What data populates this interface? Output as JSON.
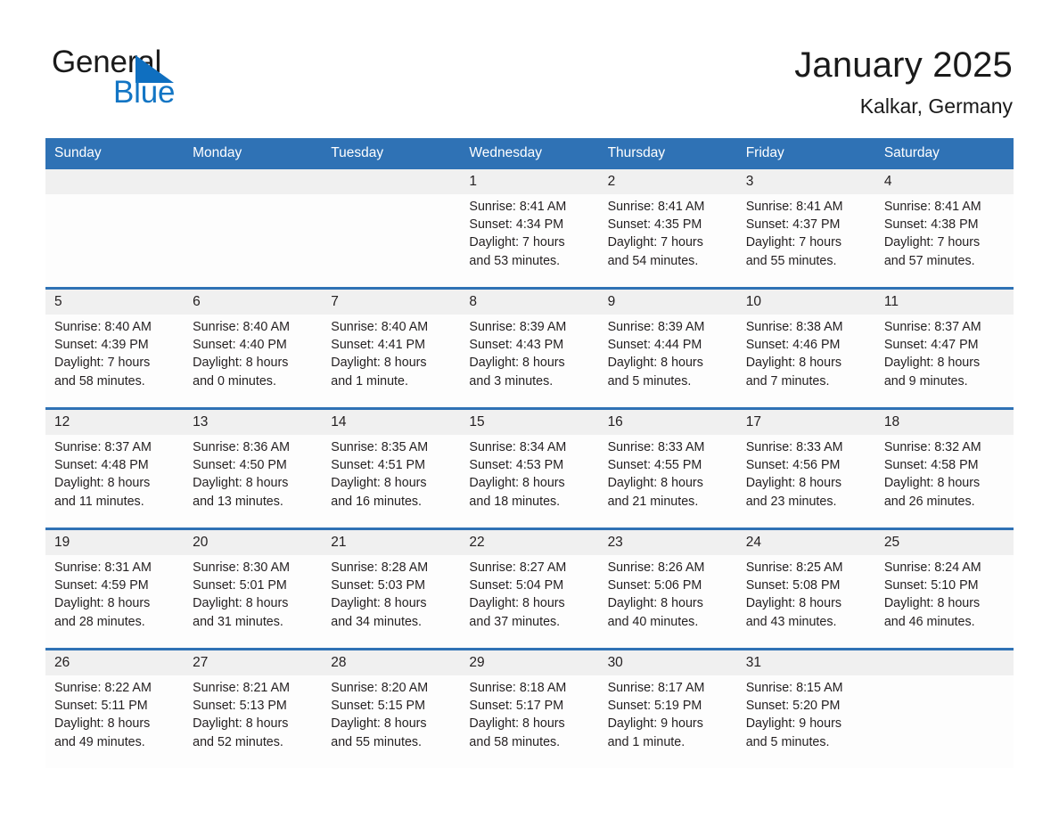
{
  "logo": {
    "word1": "General",
    "word2": "Blue",
    "triangle_color": "#0f6fc0",
    "text_color": "#1a1a1a",
    "blue_color": "#1275c4"
  },
  "header": {
    "title": "January 2025",
    "location": "Kalkar, Germany",
    "accent_color": "#2f72b5",
    "daynum_band_color": "#f0f0f0"
  },
  "weekdays": [
    "Sunday",
    "Monday",
    "Tuesday",
    "Wednesday",
    "Thursday",
    "Friday",
    "Saturday"
  ],
  "weeks": [
    [
      {
        "day": "",
        "lines": []
      },
      {
        "day": "",
        "lines": []
      },
      {
        "day": "",
        "lines": []
      },
      {
        "day": "1",
        "lines": [
          "Sunrise: 8:41 AM",
          "Sunset: 4:34 PM",
          "Daylight: 7 hours",
          "and 53 minutes."
        ]
      },
      {
        "day": "2",
        "lines": [
          "Sunrise: 8:41 AM",
          "Sunset: 4:35 PM",
          "Daylight: 7 hours",
          "and 54 minutes."
        ]
      },
      {
        "day": "3",
        "lines": [
          "Sunrise: 8:41 AM",
          "Sunset: 4:37 PM",
          "Daylight: 7 hours",
          "and 55 minutes."
        ]
      },
      {
        "day": "4",
        "lines": [
          "Sunrise: 8:41 AM",
          "Sunset: 4:38 PM",
          "Daylight: 7 hours",
          "and 57 minutes."
        ]
      }
    ],
    [
      {
        "day": "5",
        "lines": [
          "Sunrise: 8:40 AM",
          "Sunset: 4:39 PM",
          "Daylight: 7 hours",
          "and 58 minutes."
        ]
      },
      {
        "day": "6",
        "lines": [
          "Sunrise: 8:40 AM",
          "Sunset: 4:40 PM",
          "Daylight: 8 hours",
          "and 0 minutes."
        ]
      },
      {
        "day": "7",
        "lines": [
          "Sunrise: 8:40 AM",
          "Sunset: 4:41 PM",
          "Daylight: 8 hours",
          "and 1 minute."
        ]
      },
      {
        "day": "8",
        "lines": [
          "Sunrise: 8:39 AM",
          "Sunset: 4:43 PM",
          "Daylight: 8 hours",
          "and 3 minutes."
        ]
      },
      {
        "day": "9",
        "lines": [
          "Sunrise: 8:39 AM",
          "Sunset: 4:44 PM",
          "Daylight: 8 hours",
          "and 5 minutes."
        ]
      },
      {
        "day": "10",
        "lines": [
          "Sunrise: 8:38 AM",
          "Sunset: 4:46 PM",
          "Daylight: 8 hours",
          "and 7 minutes."
        ]
      },
      {
        "day": "11",
        "lines": [
          "Sunrise: 8:37 AM",
          "Sunset: 4:47 PM",
          "Daylight: 8 hours",
          "and 9 minutes."
        ]
      }
    ],
    [
      {
        "day": "12",
        "lines": [
          "Sunrise: 8:37 AM",
          "Sunset: 4:48 PM",
          "Daylight: 8 hours",
          "and 11 minutes."
        ]
      },
      {
        "day": "13",
        "lines": [
          "Sunrise: 8:36 AM",
          "Sunset: 4:50 PM",
          "Daylight: 8 hours",
          "and 13 minutes."
        ]
      },
      {
        "day": "14",
        "lines": [
          "Sunrise: 8:35 AM",
          "Sunset: 4:51 PM",
          "Daylight: 8 hours",
          "and 16 minutes."
        ]
      },
      {
        "day": "15",
        "lines": [
          "Sunrise: 8:34 AM",
          "Sunset: 4:53 PM",
          "Daylight: 8 hours",
          "and 18 minutes."
        ]
      },
      {
        "day": "16",
        "lines": [
          "Sunrise: 8:33 AM",
          "Sunset: 4:55 PM",
          "Daylight: 8 hours",
          "and 21 minutes."
        ]
      },
      {
        "day": "17",
        "lines": [
          "Sunrise: 8:33 AM",
          "Sunset: 4:56 PM",
          "Daylight: 8 hours",
          "and 23 minutes."
        ]
      },
      {
        "day": "18",
        "lines": [
          "Sunrise: 8:32 AM",
          "Sunset: 4:58 PM",
          "Daylight: 8 hours",
          "and 26 minutes."
        ]
      }
    ],
    [
      {
        "day": "19",
        "lines": [
          "Sunrise: 8:31 AM",
          "Sunset: 4:59 PM",
          "Daylight: 8 hours",
          "and 28 minutes."
        ]
      },
      {
        "day": "20",
        "lines": [
          "Sunrise: 8:30 AM",
          "Sunset: 5:01 PM",
          "Daylight: 8 hours",
          "and 31 minutes."
        ]
      },
      {
        "day": "21",
        "lines": [
          "Sunrise: 8:28 AM",
          "Sunset: 5:03 PM",
          "Daylight: 8 hours",
          "and 34 minutes."
        ]
      },
      {
        "day": "22",
        "lines": [
          "Sunrise: 8:27 AM",
          "Sunset: 5:04 PM",
          "Daylight: 8 hours",
          "and 37 minutes."
        ]
      },
      {
        "day": "23",
        "lines": [
          "Sunrise: 8:26 AM",
          "Sunset: 5:06 PM",
          "Daylight: 8 hours",
          "and 40 minutes."
        ]
      },
      {
        "day": "24",
        "lines": [
          "Sunrise: 8:25 AM",
          "Sunset: 5:08 PM",
          "Daylight: 8 hours",
          "and 43 minutes."
        ]
      },
      {
        "day": "25",
        "lines": [
          "Sunrise: 8:24 AM",
          "Sunset: 5:10 PM",
          "Daylight: 8 hours",
          "and 46 minutes."
        ]
      }
    ],
    [
      {
        "day": "26",
        "lines": [
          "Sunrise: 8:22 AM",
          "Sunset: 5:11 PM",
          "Daylight: 8 hours",
          "and 49 minutes."
        ]
      },
      {
        "day": "27",
        "lines": [
          "Sunrise: 8:21 AM",
          "Sunset: 5:13 PM",
          "Daylight: 8 hours",
          "and 52 minutes."
        ]
      },
      {
        "day": "28",
        "lines": [
          "Sunrise: 8:20 AM",
          "Sunset: 5:15 PM",
          "Daylight: 8 hours",
          "and 55 minutes."
        ]
      },
      {
        "day": "29",
        "lines": [
          "Sunrise: 8:18 AM",
          "Sunset: 5:17 PM",
          "Daylight: 8 hours",
          "and 58 minutes."
        ]
      },
      {
        "day": "30",
        "lines": [
          "Sunrise: 8:17 AM",
          "Sunset: 5:19 PM",
          "Daylight: 9 hours",
          "and 1 minute."
        ]
      },
      {
        "day": "31",
        "lines": [
          "Sunrise: 8:15 AM",
          "Sunset: 5:20 PM",
          "Daylight: 9 hours",
          "and 5 minutes."
        ]
      },
      {
        "day": "",
        "lines": []
      }
    ]
  ]
}
